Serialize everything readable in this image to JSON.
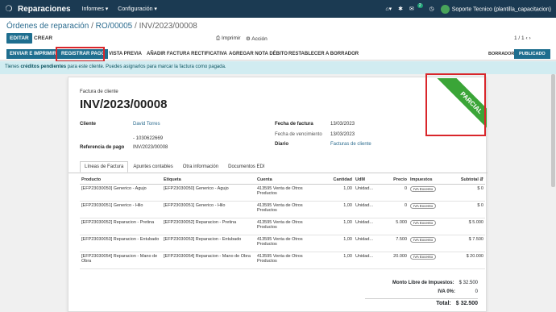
{
  "navbar": {
    "app_icon": "apps-icon",
    "brand": "Reparaciones",
    "menus": [
      "Informes ▾",
      "Configuración ▾"
    ],
    "icons": [
      "home-icon",
      "bug-icon",
      "chat-icon",
      "clock-icon"
    ],
    "chat_badge": "2",
    "user": "Soporte Tecnico (plantilla_capacitacion)"
  },
  "breadcrumb": {
    "parent": "Órdenes de reparación",
    "ro": "RO/00005",
    "current": "INV/2023/00008",
    "sep": " / "
  },
  "controls": {
    "edit": "EDITAR",
    "create": "CREAR",
    "print": "Imprimir",
    "action": "Acción",
    "pager": "1 / 1"
  },
  "statusbar": {
    "buttons": [
      "ENVIAR E IMPRIMIR",
      "REGISTRAR PAGO",
      "VISTA PREVIA",
      "AÑADIR FACTURA RECTIFICATIVA",
      "AGREGAR NOTA DÉBITO",
      "RESTABLECER A BORRADOR"
    ],
    "stages": [
      "BORRADOR",
      "PUBLICADO"
    ]
  },
  "alert": {
    "bold": "créditos pendientes",
    "pre": "Tienes ",
    "post": " para este cliente. Puedes asignarlos para marcar la factura como pagada."
  },
  "invoice": {
    "type_label": "Factura de cliente",
    "number": "INV/2023/00008",
    "ribbon": "PARCIAL",
    "client_label": "Cliente",
    "client": "David Torres",
    "client_id": "- 1030622669",
    "ref_label": "Referencia de pago",
    "ref": "INV/2023/00008",
    "date_label": "Fecha de factura",
    "date": "13/03/2023",
    "due_label": "Fecha de vencimiento",
    "due": "13/03/2023",
    "journal_label": "Diario",
    "journal": "Facturas de cliente"
  },
  "tabs": [
    "Líneas de Factura",
    "Apuntes contables",
    "Otra información",
    "Documentos EDI"
  ],
  "table": {
    "headers": [
      "Producto",
      "Etiqueta",
      "Cuenta",
      "Cantidad",
      "UdM",
      "Precio",
      "Impuestos",
      "Subtotal"
    ],
    "rows": [
      {
        "product": "[EFP23030050] Generico - Agujo",
        "label": "[EFP23030050] Generico - Agujo",
        "account": "413595 Venta de Otros Productos",
        "qty": "1,00",
        "uom": "Unidad...",
        "price": "0",
        "tax": "IVA Excento",
        "subtotal": "$ 0"
      },
      {
        "product": "[EFP23030051] Generico - Hilo",
        "label": "[EFP23030051] Generico - Hilo",
        "account": "413595 Venta de Otros Productos",
        "qty": "1,00",
        "uom": "Unidad...",
        "price": "0",
        "tax": "IVA Excento",
        "subtotal": "$ 0"
      },
      {
        "product": "[EFP23030052] Reparacion - Pretina",
        "label": "[EFP23030052] Reparacion - Pretina",
        "account": "413595 Venta de Otros Productos",
        "qty": "1,00",
        "uom": "Unidad...",
        "price": "5.000",
        "tax": "IVA Excento",
        "subtotal": "$ 5.000"
      },
      {
        "product": "[EFP23030053] Reparacion - Entubado",
        "label": "[EFP23030053] Reparacion - Entubado",
        "account": "413595 Venta de Otros Productos",
        "qty": "1,00",
        "uom": "Unidad...",
        "price": "7.500",
        "tax": "IVA Excento",
        "subtotal": "$ 7.500"
      },
      {
        "product": "[EFP23030054] Reparacion - Mano de Obra",
        "label": "[EFP23030054] Reparacion - Mano de Obra",
        "account": "413595 Venta de Otros Productos",
        "qty": "1,00",
        "uom": "Unidad...",
        "price": "20.000",
        "tax": "IVA Excento",
        "subtotal": "$ 20.000"
      }
    ]
  },
  "totals": {
    "base_label": "Monto Libre de Impuestos:",
    "base": "$ 32.500",
    "iva_label": "IVA 0%:",
    "iva": "0",
    "total_label": "Total:",
    "total": "$ 32.500"
  },
  "colors": {
    "navbar": "#1b3a52",
    "primary": "#1e6e8f",
    "ribbon": "#3aa537",
    "highlight": "#d9262b"
  }
}
